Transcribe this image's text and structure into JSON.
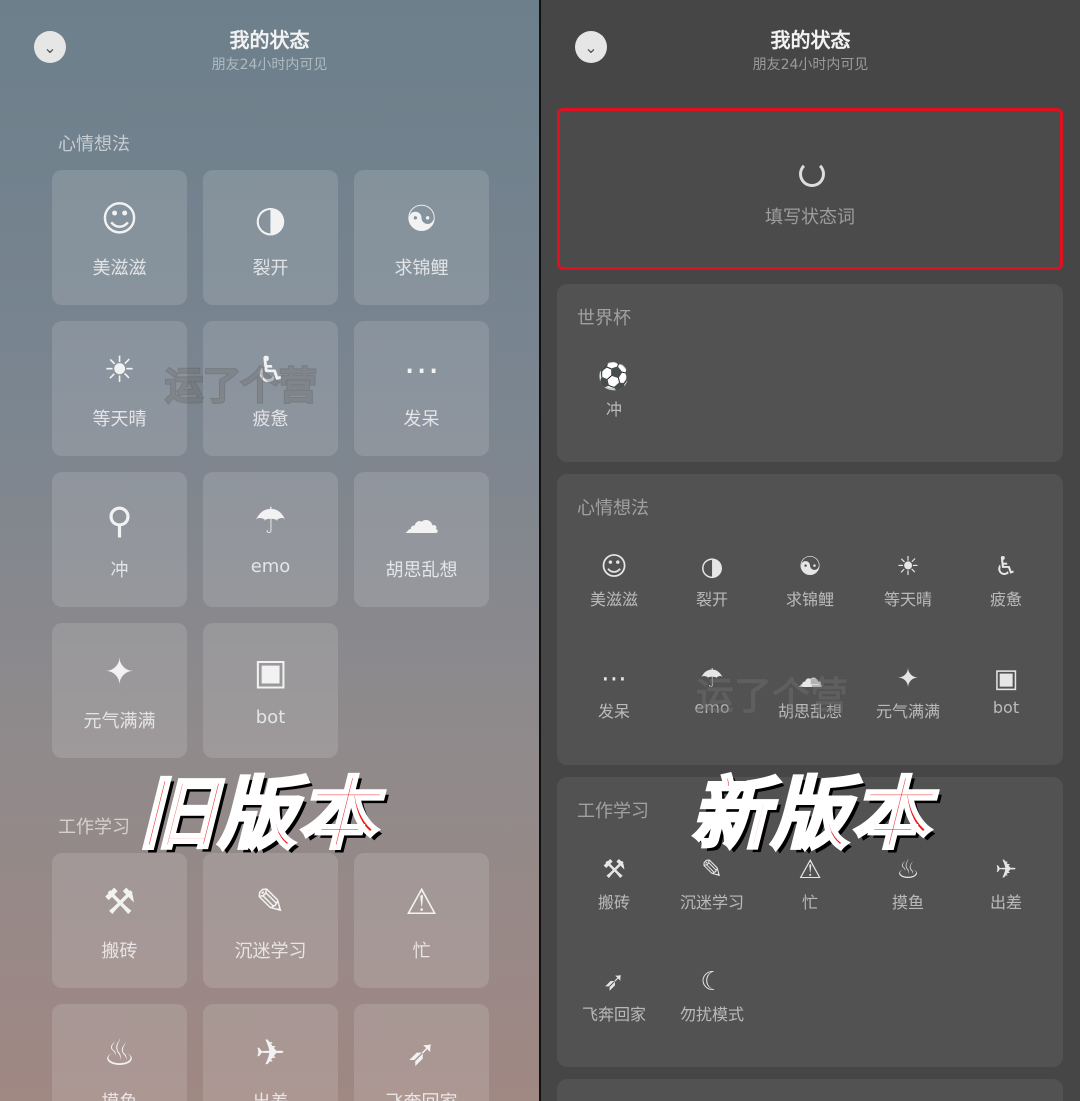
{
  "old": {
    "title": "我的状态",
    "subtitle": "朋友24小时内可见",
    "sections": [
      {
        "label": "心情想法",
        "items": [
          {
            "label": "美滋滋",
            "icon": "smile-icon",
            "glyph": "☺"
          },
          {
            "label": "裂开",
            "icon": "cracked-face-icon",
            "glyph": "◑"
          },
          {
            "label": "求锦鲤",
            "icon": "koi-icon",
            "glyph": "☯"
          },
          {
            "label": "等天晴",
            "icon": "sun-icon",
            "glyph": "☀"
          },
          {
            "label": "疲惫",
            "icon": "tired-person-icon",
            "glyph": "♿"
          },
          {
            "label": "发呆",
            "icon": "daze-person-icon",
            "glyph": "⋯"
          },
          {
            "label": "冲",
            "icon": "charge-person-icon",
            "glyph": "⚲"
          },
          {
            "label": "emo",
            "icon": "emo-person-icon",
            "glyph": "☂"
          },
          {
            "label": "胡思乱想",
            "icon": "thought-cloud-icon",
            "glyph": "☁"
          },
          {
            "label": "元气满满",
            "icon": "energetic-person-icon",
            "glyph": "✦"
          },
          {
            "label": "bot",
            "icon": "robot-icon",
            "glyph": "▣"
          }
        ]
      },
      {
        "label": "工作学习",
        "items": [
          {
            "label": "搬砖",
            "icon": "brick-moving-icon",
            "glyph": "⚒"
          },
          {
            "label": "沉迷学习",
            "icon": "studying-icon",
            "glyph": "✎"
          },
          {
            "label": "忙",
            "icon": "busy-person-icon",
            "glyph": "⚠"
          },
          {
            "label": "摸鱼",
            "icon": "slacking-icon",
            "glyph": "♨"
          },
          {
            "label": "出差",
            "icon": "airplane-icon",
            "glyph": "✈"
          },
          {
            "label": "飞奔回家",
            "icon": "running-home-icon",
            "glyph": "➶"
          }
        ]
      }
    ],
    "stamp": "旧版本"
  },
  "new": {
    "title": "我的状态",
    "subtitle": "朋友24小时内可见",
    "input_placeholder": "填写状态词",
    "sections": [
      {
        "label": "世界杯",
        "items": [
          {
            "label": "冲",
            "icon": "soccer-ball-icon",
            "glyph": "⚽"
          }
        ]
      },
      {
        "label": "心情想法",
        "items": [
          {
            "label": "美滋滋",
            "icon": "smile-icon",
            "glyph": "☺"
          },
          {
            "label": "裂开",
            "icon": "cracked-face-icon",
            "glyph": "◑"
          },
          {
            "label": "求锦鲤",
            "icon": "koi-icon",
            "glyph": "☯"
          },
          {
            "label": "等天晴",
            "icon": "sun-icon",
            "glyph": "☀"
          },
          {
            "label": "疲惫",
            "icon": "tired-person-icon",
            "glyph": "♿"
          },
          {
            "label": "发呆",
            "icon": "daze-person-icon",
            "glyph": "⋯"
          },
          {
            "label": "emo",
            "icon": "emo-person-icon",
            "glyph": "☂"
          },
          {
            "label": "胡思乱想",
            "icon": "thought-cloud-icon",
            "glyph": "☁"
          },
          {
            "label": "元气满满",
            "icon": "energetic-person-icon",
            "glyph": "✦"
          },
          {
            "label": "bot",
            "icon": "robot-icon",
            "glyph": "▣"
          }
        ]
      },
      {
        "label": "工作学习",
        "items": [
          {
            "label": "搬砖",
            "icon": "brick-moving-icon",
            "glyph": "⚒"
          },
          {
            "label": "沉迷学习",
            "icon": "studying-icon",
            "glyph": "✎"
          },
          {
            "label": "忙",
            "icon": "busy-person-icon",
            "glyph": "⚠"
          },
          {
            "label": "摸鱼",
            "icon": "slacking-icon",
            "glyph": "♨"
          },
          {
            "label": "出差",
            "icon": "airplane-icon",
            "glyph": "✈"
          },
          {
            "label": "飞奔回家",
            "icon": "running-home-icon",
            "glyph": "➶"
          },
          {
            "label": "勿扰模式",
            "icon": "moon-icon",
            "glyph": "☾"
          }
        ]
      }
    ],
    "stamp": "新版本"
  },
  "watermark": "运了个营",
  "accent_color": "#e01020"
}
